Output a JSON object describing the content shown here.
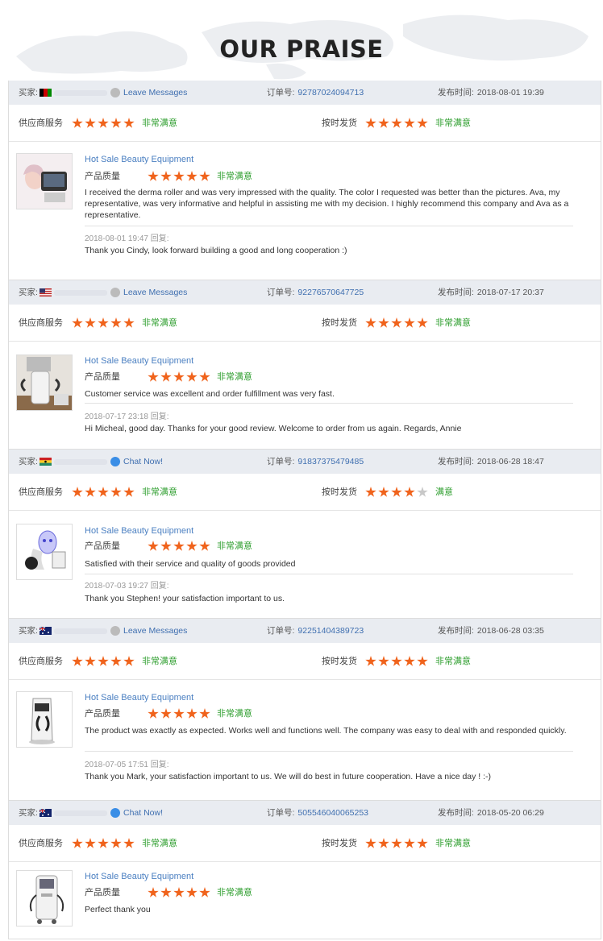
{
  "title": "OUR PRAISE",
  "labels": {
    "buyer": "买家:",
    "order": "订单号:",
    "date": "发布时间:",
    "supplier_service": "供应商服务",
    "on_time": "按时发货",
    "quality": "产品质量",
    "reply": "回复:"
  },
  "colors": {
    "star": "#f0631c",
    "star_empty": "#c8c8c8",
    "link": "#3f6fb0",
    "rating_text": "#2e9e2e",
    "header_bg": "#e9ecf1"
  },
  "reviews": [
    {
      "flag": "afghanistan",
      "contact_icon": "grey-message-icon",
      "contact_label": "Leave Messages",
      "order_no": "92787024094713",
      "date": "2018-08-01 19:39",
      "supplier_rating": 5,
      "supplier_text": "非常满意",
      "delivery_rating": 5,
      "delivery_text": "非常满意",
      "product": "Hot Sale Beauty Equipment",
      "quality_rating": 5,
      "quality_text": "非常满意",
      "thumb_icon": "beauty-machine-woman-image",
      "comment": "I received the derma roller and was very impressed with the quality. The color I requested was better than the pictures. Ava, my representative, was very informative and helpful in assisting me with my decision. I highly recommend this company and Ava as a representative.",
      "reply_date": "2018-08-01 19:47",
      "reply": "Thank you Cindy, look forward building a good and long cooperation :)"
    },
    {
      "flag": "usa",
      "contact_icon": "grey-message-icon",
      "contact_label": "Leave Messages",
      "order_no": "92276570647725",
      "date": "2018-07-17 20:37",
      "supplier_rating": 5,
      "supplier_text": "非常满意",
      "delivery_rating": 5,
      "delivery_text": "非常满意",
      "product": "Hot Sale Beauty Equipment",
      "quality_rating": 5,
      "quality_text": "非常满意",
      "thumb_icon": "slimming-machine-image",
      "comment": "Customer service was excellent and order fulfillment was very fast.",
      "reply_date": "2018-07-17 23:18",
      "reply": "Hi Micheal, good day. Thanks for your good review. Welcome to order from us again. Regards, Annie"
    },
    {
      "flag": "ghana",
      "contact_icon": "blue-chat-icon",
      "contact_label": "Chat Now!",
      "order_no": "91837375479485",
      "date": "2018-06-28 18:47",
      "supplier_rating": 5,
      "supplier_text": "非常满意",
      "delivery_rating": 4,
      "delivery_text": "满意",
      "product": "Hot Sale Beauty Equipment",
      "quality_rating": 5,
      "quality_text": "非常满意",
      "thumb_icon": "led-mask-image",
      "comment": "Satisfied with their service and quality of goods provided",
      "reply_date": "2018-07-03 19:27",
      "reply": "Thank you Stephen! your satisfaction important to us."
    },
    {
      "flag": "australia",
      "contact_icon": "grey-message-icon",
      "contact_label": "Leave Messages",
      "order_no": "92251404389723",
      "date": "2018-06-28 03:35",
      "supplier_rating": 5,
      "supplier_text": "非常满意",
      "delivery_rating": 5,
      "delivery_text": "非常满意",
      "product": "Hot Sale Beauty Equipment",
      "quality_rating": 5,
      "quality_text": "非常满意",
      "thumb_icon": "ipl-machine-image",
      "comment": "The product was exactly as expected. Works well and functions well. The company was easy to deal with and responded quickly.",
      "reply_date": "2018-07-05 17:51",
      "reply": "Thank you Mark, your satisfaction important to us. We will do best in future cooperation. Have a nice day ! :-)"
    },
    {
      "flag": "australia",
      "contact_icon": "blue-chat-icon",
      "contact_label": "Chat Now!",
      "order_no": "505546040065253",
      "date": "2018-05-20 06:29",
      "supplier_rating": 5,
      "supplier_text": "非常满意",
      "delivery_rating": 5,
      "delivery_text": "非常满意",
      "product": "Hot Sale Beauty Equipment",
      "quality_rating": 5,
      "quality_text": "非常满意",
      "thumb_icon": "tower-machine-image",
      "comment": "Perfect thank you",
      "reply_date": "",
      "reply": ""
    }
  ]
}
